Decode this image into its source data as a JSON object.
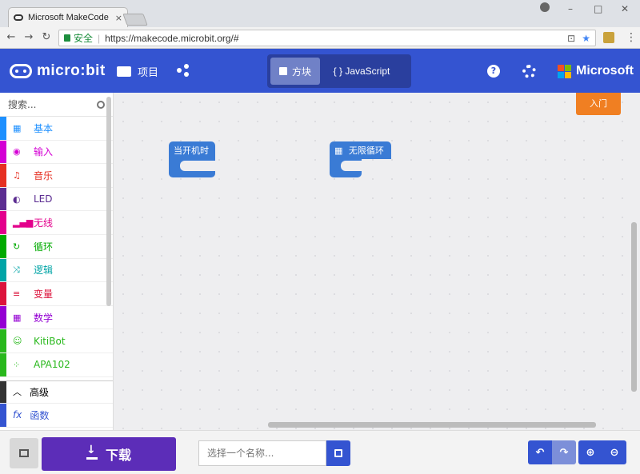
{
  "browser": {
    "tab_title": "Microsoft MakeCode fo",
    "tab_close": "×",
    "secure_label": "安全",
    "url": "https://makecode.microbit.org/#",
    "win_min": "–",
    "win_max": "□",
    "win_close": "✕"
  },
  "header": {
    "logo_text": "micro:bit",
    "projects_label": "项目",
    "blocks_label": "方块",
    "javascript_label": "{ } JavaScript",
    "help_icon": "?",
    "brand": "Microsoft"
  },
  "toolbox": {
    "search_placeholder": "搜索...",
    "categories": [
      {
        "label": "基本",
        "color": "#1e90ff",
        "icon": "grid-icon"
      },
      {
        "label": "输入",
        "color": "#d400d4",
        "icon": "target-icon"
      },
      {
        "label": "音乐",
        "color": "#e63022",
        "icon": "headphones-icon"
      },
      {
        "label": "LED",
        "color": "#5c2d91",
        "icon": "toggle-icon"
      },
      {
        "label": "无线",
        "color": "#e3008c",
        "icon": "signal-icon"
      },
      {
        "label": "循环",
        "color": "#00aa00",
        "icon": "refresh-icon"
      },
      {
        "label": "逻辑",
        "color": "#00a4a6",
        "icon": "shuffle-icon"
      },
      {
        "label": "变量",
        "color": "#dc143c",
        "icon": "list-icon"
      },
      {
        "label": "数学",
        "color": "#9400d3",
        "icon": "calculator-icon"
      },
      {
        "label": "KitiBot",
        "color": "#29b81c",
        "icon": "robot-icon"
      },
      {
        "label": "APA102",
        "color": "#29b81c",
        "icon": "dots-icon"
      }
    ],
    "advanced_label": "高级",
    "functions_label": "函数"
  },
  "workspace": {
    "intro_label": "入门",
    "on_start_label": "当开机时",
    "forever_label": "无限循环"
  },
  "bottom": {
    "download_label": "下载",
    "name_placeholder": "选择一个名称..."
  }
}
